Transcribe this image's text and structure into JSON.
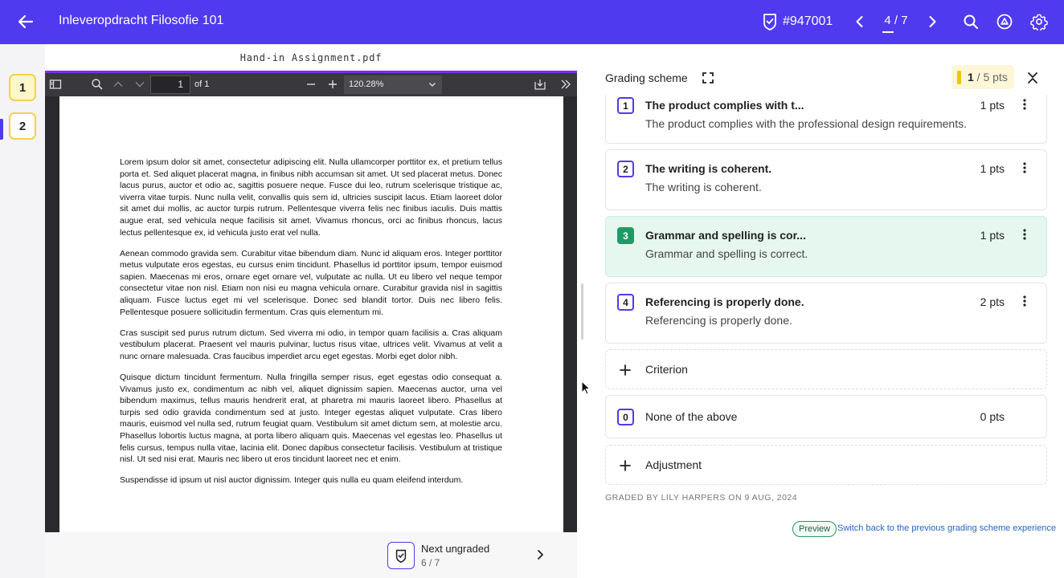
{
  "header": {
    "title": "Inleveropdracht Filosofie 101",
    "submission_id": "#947001",
    "counter": "4 / 7"
  },
  "pages": [
    "1",
    "2"
  ],
  "viewer": {
    "filename": "Hand-in Assignment.pdf",
    "page_input": "1",
    "page_of": "of 1",
    "zoom": "120.28%",
    "paragraphs": [
      "Lorem ipsum dolor sit amet, consectetur adipiscing elit. Nulla ullamcorper porttitor ex, et pretium tellus porta et. Sed aliquet placerat magna, in finibus nibh accumsan sit amet. Ut sed placerat metus. Donec lacus purus, auctor et odio ac, sagittis posuere neque. Fusce dui leo, rutrum scelerisque tristique ac, viverra vitae turpis. Nunc nulla velit, convallis quis sem id, ultricies suscipit lacus. Etiam laoreet dolor sit amet dui mollis, ac auctor turpis rutrum. Pellentesque viverra felis nec finibus iaculis. Duis mattis augue erat, sed vehicula neque facilisis sit amet. Vivamus rhoncus, orci ac finibus rhoncus, lacus lectus pellentesque ex, id vehicula justo erat vel nulla.",
      "Aenean commodo gravida sem. Curabitur vitae bibendum diam. Nunc id aliquam eros. Integer porttitor metus vulputate eros egestas, eu cursus enim tincidunt. Phasellus id porttitor ipsum, tempor euismod sapien. Maecenas mi eros, ornare eget ornare vel, vulputate ac nulla. Ut eu libero vel neque tempor consectetur vitae non nisl. Etiam non nisi eu magna vehicula ornare. Curabitur gravida nisl in sagittis aliquam. Fusce luctus eget mi vel scelerisque. Donec sed blandit tortor. Duis nec libero felis. Pellentesque posuere sollicitudin fermentum. Cras quis elementum mi.",
      "Cras suscipit sed purus rutrum dictum. Sed viverra mi odio, in tempor quam facilisis a. Cras aliquam vestibulum placerat. Praesent vel mauris pulvinar, luctus risus vitae, ultrices velit. Vivamus at velit a nunc ornare malesuada. Cras faucibus imperdiet arcu eget egestas. Morbi eget dolor nibh.",
      "Quisque dictum tincidunt fermentum. Nulla fringilla semper risus, eget egestas odio consequat a. Vivamus justo ex, condimentum ac nibh vel, aliquet dignissim sapien. Maecenas auctor, urna vel bibendum maximus, tellus mauris hendrerit erat, at pharetra mi mauris laoreet libero. Phasellus at turpis sed odio gravida condimentum sed at justo. Integer egestas aliquet vulputate. Cras libero mauris, euismod vel nulla sed, rutrum feugiat quam. Vestibulum sit amet dictum sem, at molestie arcu. Phasellus lobortis luctus magna, at porta libero aliquam quis. Maecenas vel egestas leo. Phasellus ut felis cursus, tempus nulla vitae, lacinia elit. Donec dapibus consectetur facilisis. Vestibulum at tristique nisl. Ut sed nisi erat. Mauris nec libero ut eros tincidunt laoreet nec et enim.",
      "Suspendisse id ipsum ut nisl auctor dignissim. Integer quis nulla eu quam eleifend interdum."
    ]
  },
  "next_ungraded": {
    "label": "Next ungraded",
    "count": "6 / 7"
  },
  "grading": {
    "title": "Grading scheme",
    "points_current": "1",
    "points_total": " / 5 pts",
    "criteria": [
      {
        "num": "1",
        "title": "The product complies with t...",
        "desc": "The product complies with the professional design requirements.",
        "pts": "1 pts"
      },
      {
        "num": "2",
        "title": "The writing is coherent.",
        "desc": "The writing is coherent.",
        "pts": "1 pts"
      },
      {
        "num": "3",
        "title": "Grammar and spelling is cor...",
        "desc": "Grammar and spelling is correct.",
        "pts": "1 pts"
      },
      {
        "num": "4",
        "title": "Referencing is properly done.",
        "desc": "Referencing is properly done.",
        "pts": "2 pts"
      }
    ],
    "add_criterion": "Criterion",
    "none_num": "0",
    "none_label": "None of the above",
    "none_pts": "0 pts",
    "add_adjustment": "Adjustment",
    "graded_by": "GRADED BY LILY HARPERS ON 9 AUG, 2024",
    "preview_badge": "Preview",
    "switch_link": "Switch back to the previous grading scheme experience"
  },
  "colors": {
    "brand": "#4f3aef",
    "selected_bg": "#e6f7ef",
    "selected_num": "#1f9a66",
    "points_bar": "#f2c500"
  }
}
